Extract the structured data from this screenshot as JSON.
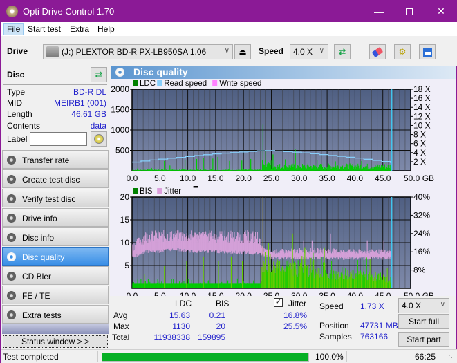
{
  "window": {
    "title": "Opti Drive Control 1.70",
    "controls": [
      "minimize",
      "maximize",
      "close"
    ]
  },
  "menu": [
    {
      "label": "File",
      "active": true
    },
    {
      "label": "Start test"
    },
    {
      "label": "Extra"
    },
    {
      "label": "Help"
    }
  ],
  "toolbar": {
    "drive_label": "Drive",
    "drive_value": "(J:)  PLEXTOR BD-R  PX-LB950SA 1.06",
    "speed_label": "Speed",
    "speed_value": "4.0 X",
    "icons": [
      "eject-icon",
      "refresh-icon",
      "erase-icon",
      "settings-icon",
      "save-icon"
    ]
  },
  "disc": {
    "header": "Disc",
    "fields": [
      {
        "key": "Type",
        "value": "BD-R DL"
      },
      {
        "key": "MID",
        "value": "MEIRB1 (001)"
      },
      {
        "key": "Length",
        "value": "46.61 GB"
      },
      {
        "key": "Contents",
        "value": "data"
      }
    ],
    "label_key": "Label",
    "label_value": ""
  },
  "nav": [
    {
      "label": "Transfer rate"
    },
    {
      "label": "Create test disc"
    },
    {
      "label": "Verify test disc"
    },
    {
      "label": "Drive info"
    },
    {
      "label": "Disc info"
    },
    {
      "label": "Disc quality",
      "active": true
    },
    {
      "label": "CD Bler"
    },
    {
      "label": "FE / TE"
    },
    {
      "label": "Extra tests"
    }
  ],
  "status_window_button": "Status window > >",
  "panel": {
    "title": "Disc quality"
  },
  "chart_data": [
    {
      "type": "bar",
      "title": "LDC / Read speed",
      "legend": [
        {
          "name": "LDC",
          "color": "#008000"
        },
        {
          "name": "Read speed",
          "color": "#87cefa"
        },
        {
          "name": "Write speed",
          "color": "#ff80ff"
        }
      ],
      "legend_position": "top-left",
      "xlabel": "GB",
      "xlim": [
        0,
        50
      ],
      "x_ticks": [
        "0.0",
        "5.0",
        "10.0",
        "15.0",
        "20.0",
        "25.0",
        "30.0",
        "35.0",
        "40.0",
        "45.0",
        "50.0 GB"
      ],
      "ylim_left": [
        0,
        2000
      ],
      "y_ticks_left": [
        "2000",
        "1500",
        "1000",
        "500"
      ],
      "ylim_right": [
        0,
        18
      ],
      "y_ticks_right": [
        "18 X",
        "16 X",
        "14 X",
        "12 X",
        "10 X",
        "8 X",
        "6 X",
        "4 X",
        "2 X"
      ],
      "grid": true,
      "disc_end_gb": 46.61,
      "series": [
        {
          "name": "Read speed (X)",
          "x": [
            0,
            2.5,
            5,
            7.5,
            10,
            12.5,
            15,
            17.5,
            20,
            22.5,
            23.5,
            25,
            27.5,
            30,
            32.5,
            35,
            37.5,
            40,
            42.5,
            45,
            46.6
          ],
          "values": [
            1.9,
            2.3,
            2.6,
            2.9,
            3.2,
            3.5,
            3.8,
            4.0,
            4.2,
            4.4,
            4.5,
            4.4,
            4.2,
            4.0,
            3.7,
            3.4,
            3.1,
            2.8,
            2.4,
            2.0,
            1.73
          ]
        },
        {
          "name": "LDC peaks",
          "x": [
            1,
            3.5,
            5.8,
            6.8,
            9.5,
            11.6,
            12.8,
            14.5,
            15.4,
            17.5,
            19.7,
            21.3,
            23.5,
            23.9,
            25.3,
            27.5,
            29.3,
            33.2,
            36.5,
            41.2,
            45.6
          ],
          "values": [
            60,
            70,
            240,
            130,
            260,
            290,
            320,
            300,
            340,
            240,
            250,
            290,
            1130,
            480,
            400,
            280,
            520,
            260,
            230,
            240,
            200
          ]
        }
      ]
    },
    {
      "type": "bar",
      "title": "BIS / Jitter",
      "legend": [
        {
          "name": "BIS",
          "color": "#008000"
        },
        {
          "name": "Jitter",
          "color": "#dda0dd"
        }
      ],
      "legend_position": "top-left",
      "xlabel": "GB",
      "xlim": [
        0,
        50
      ],
      "x_ticks": [
        "0.0",
        "5.0",
        "10.0",
        "15.0",
        "20.0",
        "25.0",
        "30.0",
        "35.0",
        "40.0",
        "45.0",
        "50.0 GB"
      ],
      "ylim_left": [
        0,
        20
      ],
      "y_ticks_left": [
        "20",
        "15",
        "10",
        "5"
      ],
      "ylim_right": [
        0,
        40
      ],
      "y_ticks_right": [
        "40%",
        "32%",
        "24%",
        "16%",
        "8%"
      ],
      "grid": true,
      "disc_end_gb": 46.61,
      "series": [
        {
          "name": "Jitter band (%)",
          "x": [
            0,
            2.5,
            5,
            7.5,
            10,
            12.5,
            15,
            17.5,
            20,
            22.5,
            23.5,
            25,
            30,
            35,
            40,
            45,
            46.6
          ],
          "low": [
            14,
            17,
            17,
            18,
            17,
            17,
            17,
            16.5,
            16.5,
            16,
            15.5,
            14,
            14,
            14,
            14,
            14,
            14
          ],
          "high": [
            20,
            25.5,
            25.5,
            25.5,
            25.5,
            25.5,
            25.5,
            25.5,
            25.5,
            25.5,
            18,
            17.5,
            18,
            18,
            17.5,
            17.5,
            17
          ]
        },
        {
          "name": "BIS base",
          "x": [
            0,
            23.3,
            23.5,
            30,
            35,
            40,
            46.6
          ],
          "values": [
            1,
            1,
            6,
            4,
            3,
            3,
            2
          ]
        },
        {
          "name": "BIS peaks",
          "x": [
            2.2,
            5.8,
            9.8,
            12.8,
            15.5,
            17.8,
            19.8,
            23.5,
            24.5,
            28.8,
            31,
            34.5
          ],
          "values": [
            3,
            5,
            6,
            7,
            6,
            7,
            6,
            20,
            10,
            12,
            9,
            9
          ]
        }
      ]
    }
  ],
  "stats": {
    "col_ldc": "LDC",
    "col_bis": "BIS",
    "jitter_label": "Jitter",
    "jitter_checked": true,
    "rows": [
      {
        "label": "Avg",
        "ldc": "15.63",
        "bis": "0.21",
        "jitter": "16.8%"
      },
      {
        "label": "Max",
        "ldc": "1130",
        "bis": "20",
        "jitter": "25.5%"
      },
      {
        "label": "Total",
        "ldc": "11938338",
        "bis": "159895",
        "jitter": ""
      }
    ],
    "speed_label": "Speed",
    "speed_value": "1.73 X",
    "position_label": "Position",
    "position_value": "47731 MB",
    "samples_label": "Samples",
    "samples_value": "763166",
    "speed_select": "4.0 X",
    "start_full": "Start full",
    "start_part": "Start part"
  },
  "statusbar": {
    "text": "Test completed",
    "progress": 100.0,
    "progress_text": "100.0%",
    "time": "66:25"
  }
}
